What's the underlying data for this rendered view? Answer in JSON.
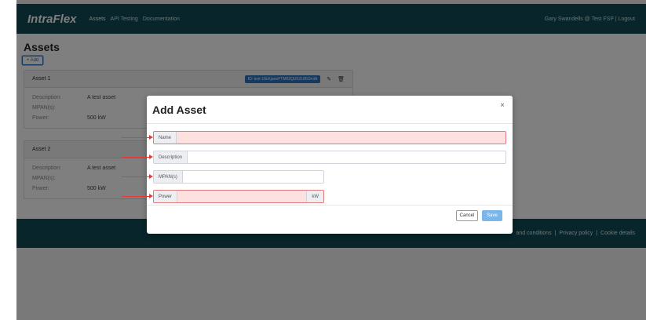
{
  "navbar": {
    "brand": "IntraFlex",
    "links": [
      "Assets",
      "API Testing",
      "Documentation"
    ],
    "user": "Gary Swandells @ Test FSP | Logout"
  },
  "page": {
    "title": "Assets",
    "add_label": "+ Add"
  },
  "assets": [
    {
      "name": "Asset 1",
      "id_badge": "ID: test-18cKjaeeFTM02QU0ZL85OmiA",
      "fields": [
        {
          "label": "Description:",
          "value": "A test asset"
        },
        {
          "label": "MPAN(s):",
          "value": ""
        },
        {
          "label": "Power:",
          "value": "500 kW"
        }
      ]
    },
    {
      "name": "Asset 2",
      "fields": [
        {
          "label": "Description:",
          "value": "A test asset"
        },
        {
          "label": "MPAN(s):",
          "value": ""
        },
        {
          "label": "Power:",
          "value": "500 kW"
        }
      ]
    }
  ],
  "footer": {
    "terms": "and conditions",
    "privacy": "Privacy policy",
    "cookies": "Cookie details",
    "separator": "|"
  },
  "modal": {
    "title": "Add Asset",
    "close": "×",
    "fields": {
      "name": "Name",
      "description": "Description",
      "mpan": "MPAN(s)",
      "power": "Power",
      "power_unit": "kW"
    },
    "cancel": "Cancel",
    "save": "Save"
  },
  "colors": {
    "navbar": "#0f4a55",
    "primary": "#2a74c4",
    "invalid_bg": "#fde1e1",
    "annotation_arrow": "#e23b3b"
  }
}
